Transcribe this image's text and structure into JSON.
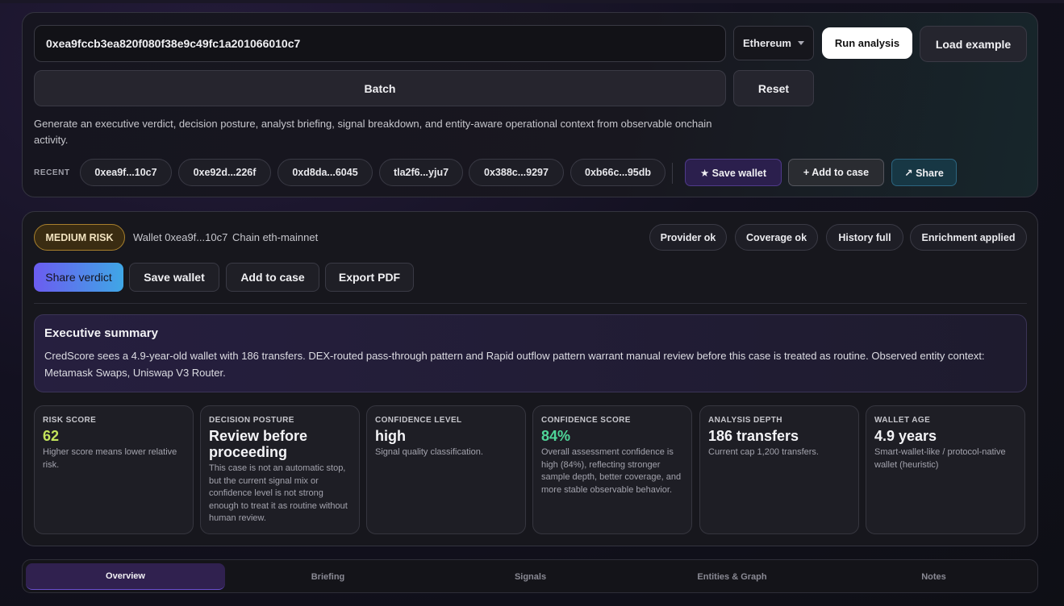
{
  "search": {
    "address": "0xea9fccb3ea820f080f38e9c49fc1a201066010c7",
    "chain": "Ethereum",
    "run_label": "Run analysis",
    "load_label": "Load example",
    "batch_label": "Batch",
    "reset_label": "Reset",
    "description": "Generate an executive verdict, decision posture, analyst briefing, signal breakdown, and entity-aware operational context from observable onchain activity."
  },
  "recent": {
    "label": "RECENT",
    "items": [
      "0xea9f...10c7",
      "0xe92d...226f",
      "0xd8da...6045",
      "tla2f6...yju7",
      "0x388c...9297",
      "0xb66c...95db"
    ],
    "save_wallet": "★ Save wallet",
    "add_to_case": "+ Add to case",
    "share": "↗ Share"
  },
  "result": {
    "risk_badge": "MEDIUM RISK",
    "wallet_text": "Wallet 0xea9f...10c7",
    "chain_text": "Chain eth-mainnet",
    "status": [
      "Provider ok",
      "Coverage ok",
      "History full",
      "Enrichment applied"
    ],
    "actions": {
      "share_verdict": "Share verdict",
      "save_wallet": "Save wallet",
      "add_to_case": "Add to case",
      "export_pdf": "Export PDF"
    },
    "summary": {
      "title": "Executive summary",
      "body": "CredScore sees a 4.9-year-old wallet with 186 transfers. DEX-routed pass-through pattern and Rapid outflow pattern warrant manual review before this case is treated as routine. Observed entity context: Metamask Swaps, Uniswap V3 Router."
    },
    "cards": [
      {
        "label": "RISK SCORE",
        "value": "62",
        "note": "Higher score means lower relative risk."
      },
      {
        "label": "DECISION POSTURE",
        "value": "Review before proceeding",
        "note": "This case is not an automatic stop, but the current signal mix or confidence level is not strong enough to treat it as routine without human review."
      },
      {
        "label": "CONFIDENCE LEVEL",
        "value": "high",
        "note": "Signal quality classification."
      },
      {
        "label": "CONFIDENCE SCORE",
        "value": "84%",
        "note": "Overall assessment confidence is high (84%), reflecting stronger sample depth, better coverage, and more stable observable behavior."
      },
      {
        "label": "ANALYSIS DEPTH",
        "value": "186 transfers",
        "note": "Current cap 1,200 transfers."
      },
      {
        "label": "WALLET AGE",
        "value": "4.9 years",
        "note": "Smart-wallet-like / protocol-native wallet (heuristic)"
      }
    ]
  },
  "tabs": [
    "Overview",
    "Briefing",
    "Signals",
    "Entities & Graph",
    "Notes"
  ],
  "colors": {
    "accent_purple": "#6b5cf0",
    "accent_blue": "#3fa7e6",
    "risk_medium": "#a8802d",
    "score_value": "#c3e45b",
    "confidence_value": "#4fd699"
  }
}
